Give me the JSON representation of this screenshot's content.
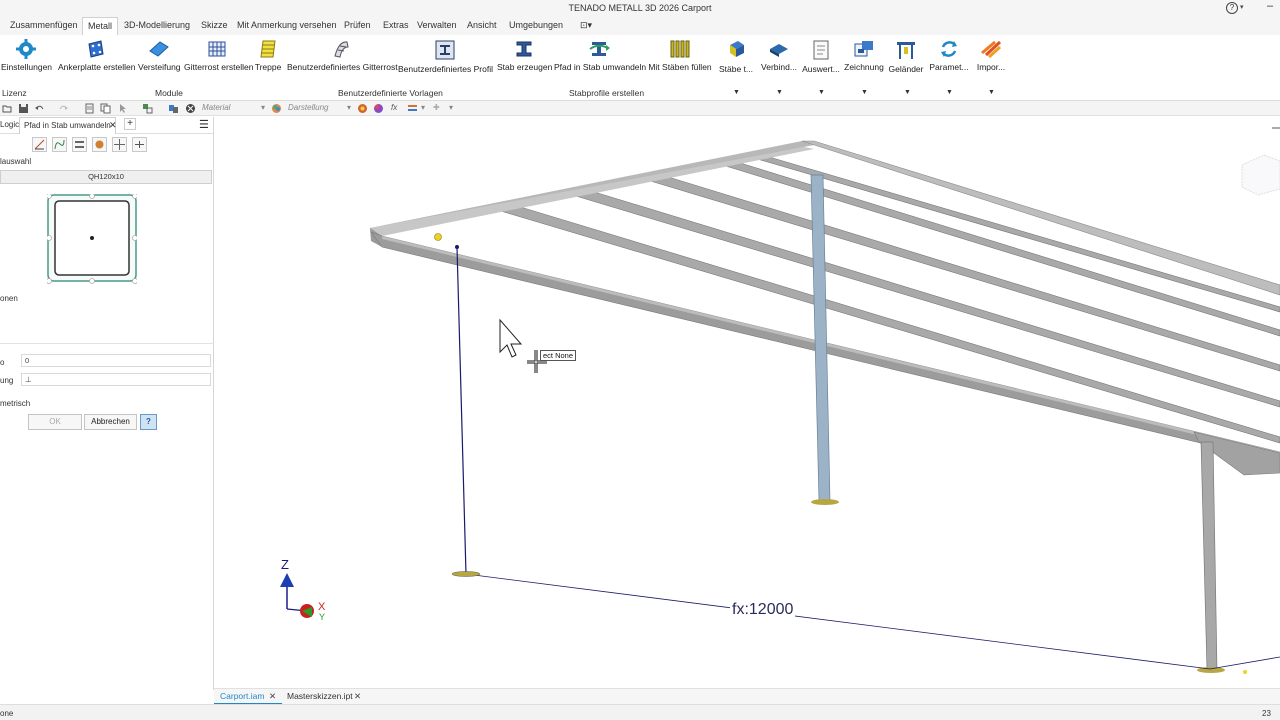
{
  "window": {
    "title": "TENADO METALL 3D 2026   Carport"
  },
  "ribbon_tabs": [
    "Zusammenfügen",
    "Metall",
    "3D-Modellierung",
    "Skizze",
    "Mit Anmerkung versehen",
    "Prüfen",
    "Extras",
    "Verwalten",
    "Ansicht",
    "Umgebungen"
  ],
  "active_tab": "Metall",
  "ribbon": {
    "buttons": [
      {
        "label": "Einstellungen",
        "icon": "gear-icon"
      },
      {
        "label": "Ankerplatte erstellen",
        "icon": "anchor-plate-icon"
      },
      {
        "label": "Versteifung",
        "icon": "stiffener-icon"
      },
      {
        "label": "Gitterrost erstellen",
        "icon": "grating-icon"
      },
      {
        "label": "Treppe",
        "icon": "stairs-icon"
      },
      {
        "label": "Benutzerdefiniertes Gitterrost",
        "icon": "custom-grating-icon"
      },
      {
        "label": "Benutzerdefiniertes Profil",
        "icon": "custom-profile-icon"
      },
      {
        "label": "Stab erzeugen",
        "icon": "create-beam-icon"
      },
      {
        "label": "Pfad in Stab umwandeln",
        "icon": "path-to-beam-icon"
      },
      {
        "label": "Mit Stäben füllen",
        "icon": "fill-beams-icon"
      },
      {
        "label": "Stäbe t...",
        "icon": "beams-icon"
      },
      {
        "label": "Verbind...",
        "icon": "connection-icon"
      },
      {
        "label": "Auswert...",
        "icon": "report-icon"
      },
      {
        "label": "Zeichnung",
        "icon": "drawing-icon"
      },
      {
        "label": "Geländer",
        "icon": "railing-icon"
      },
      {
        "label": "Paramet...",
        "icon": "parameter-icon"
      },
      {
        "label": "Impor...",
        "icon": "import-icon"
      }
    ],
    "panels": {
      "lizenz": "Lizenz",
      "module": "Module",
      "vorlagen": "Benutzerdefinierte Vorlagen",
      "stabprofile": "Stabprofile erstellen"
    }
  },
  "quick_toolbar": {
    "material": "Material",
    "darstellung": "Darstellung"
  },
  "left_panel": {
    "tab_logic": "Logic",
    "tab_active": "Pfad in Stab umwandeln",
    "section_auswahl": "lauswahl",
    "profile_name": "QH120x10",
    "section_optionen": "onen",
    "field1_value": "0",
    "field2_label": "ung",
    "field2_value": "⊥",
    "metrisch": "metrisch",
    "ok": "OK",
    "abbrechen": "Abbrechen"
  },
  "viewport": {
    "dimension": "fx:12000",
    "tooltip": "ect None",
    "axes": {
      "z": "Z",
      "x": "X",
      "y": "Y"
    }
  },
  "doc_tabs": [
    "Carport.iam",
    "Masterskizzen.ipt"
  ],
  "status": {
    "left": "one",
    "right": "23"
  },
  "colors": {
    "accent": "#1e88c8",
    "beam": "#9a9a9a",
    "column": "#8ea6bd",
    "sketch": "#1a1a6a"
  }
}
